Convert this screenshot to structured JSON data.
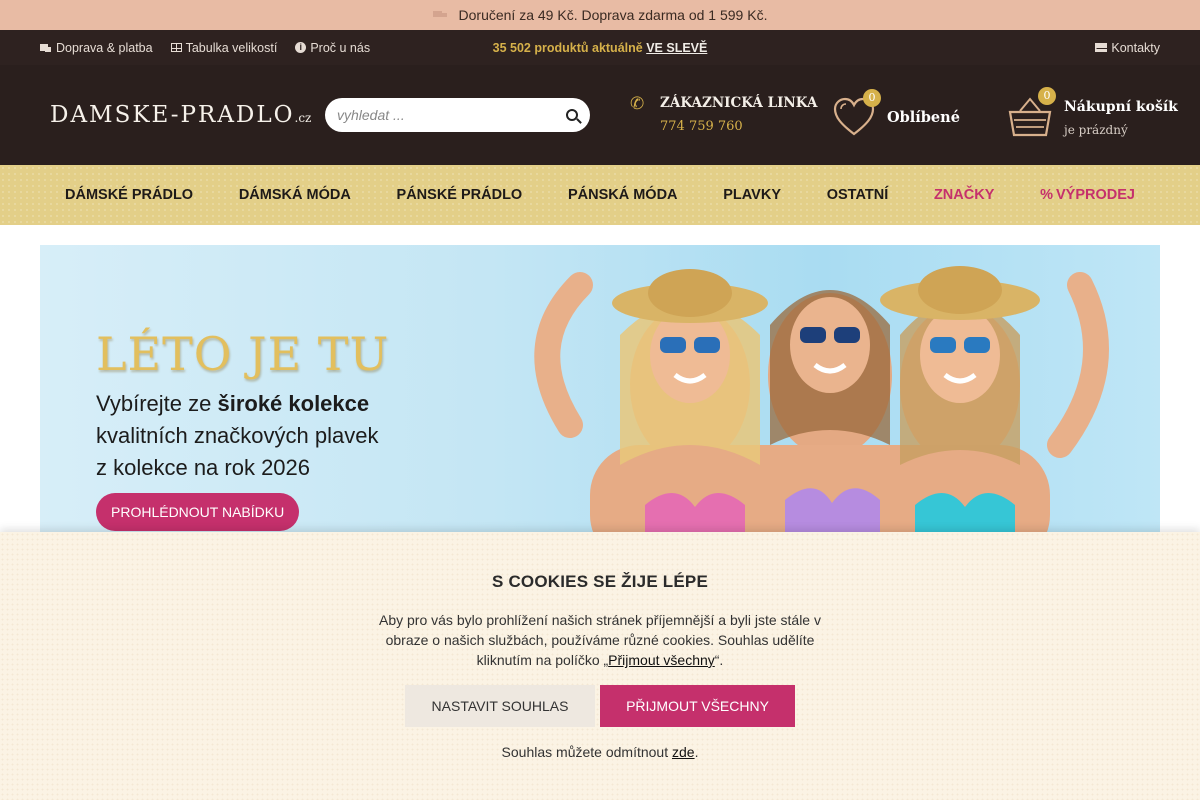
{
  "promo": {
    "text": "Doručení za 49 Kč. Doprava zdarma od 1 599 Kč."
  },
  "topbar": {
    "links": [
      "Doprava & platba",
      "Tabulka velikostí",
      "Proč u nás"
    ],
    "center_text": "35 502 produktů aktuálně",
    "center_link": "VE SLEVĚ",
    "contacts": "Kontakty"
  },
  "header": {
    "logo": "DAMSKE-PRADLO",
    "logo_tld": ".cz",
    "search_placeholder": "vyhledat ...",
    "hotline_label": "ZÁKAZNICKÁ LINKA",
    "hotline_number": "774 759 760",
    "favorites_label": "Oblíbené",
    "favorites_count": "0",
    "cart_label": "Nákupní košík",
    "cart_status": "je prázdný",
    "cart_count": "0"
  },
  "nav": {
    "items": [
      "DÁMSKÉ PRÁDLO",
      "DÁMSKÁ MÓDA",
      "PÁNSKÉ PRÁDLO",
      "PÁNSKÁ MÓDA",
      "PLAVKY",
      "OSTATNÍ",
      "ZNAČKY",
      "VÝPRODEJ"
    ]
  },
  "hero": {
    "title": "LÉTO JE TU",
    "text_1": "Vybírejte ze ",
    "text_bold": "široké kolekce",
    "text_2": "kvalitních značkových plavek",
    "text_3": "z kolekce na rok 2026",
    "button": "PROHLÉDNOUT NABÍDKU"
  },
  "cookie": {
    "title": "S COOKIES SE ŽIJE LÉPE",
    "text_1": "Aby pro vás bylo prohlížení našich stránek příjemnější a byli jste stále v obraze o našich službách, používáme různé cookies. Souhlas udělíte kliknutím na políčko „",
    "text_link": "Přijmout všechny",
    "text_2": "“.",
    "btn_settings": "NASTAVIT SOUHLAS",
    "btn_accept": "PŘIJMOUT VŠECHNY",
    "footer_text": "Souhlas můžete odmítnout ",
    "footer_link": "zde",
    "footer_end": "."
  },
  "colors": {
    "accent_pink": "#c5306c",
    "gold": "#d6b14a",
    "dark_header": "#2a1f1d",
    "nav_gold": "#e3cf88",
    "promo_bar": "#e8bba4"
  },
  "icons": [
    "truck-icon",
    "table-icon",
    "info-icon",
    "mail-icon",
    "search-icon",
    "phone-icon",
    "heart-icon",
    "basket-icon",
    "percent-icon"
  ]
}
